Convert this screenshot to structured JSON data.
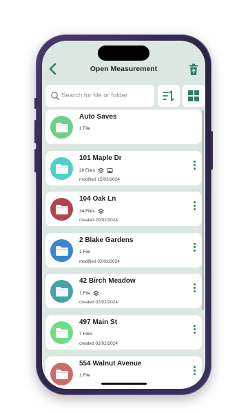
{
  "header": {
    "title": "Open Measurement",
    "back_icon": "chevron-left-icon",
    "delete_icon": "trash-icon"
  },
  "search": {
    "placeholder": "Search for file or folder",
    "sort_icon": "sort-icon",
    "view_icon": "grid-view-icon"
  },
  "colors": {
    "accent": "#2e7d63",
    "background": "#dce7e1"
  },
  "folders": [
    {
      "name": "Auto Saves",
      "files": "1 File",
      "date": "",
      "color": "#6fcf8a",
      "icons": []
    },
    {
      "name": "101 Maple Dr",
      "files": "20 Files",
      "date": "modified 15/03/2024",
      "color": "#4fd1c5",
      "icons": [
        "layers-icon",
        "image-icon"
      ]
    },
    {
      "name": "104 Oak Ln",
      "files": "34 Files",
      "date": "created 20/02/2024",
      "color": "#b0454e",
      "icons": [
        "layers-icon"
      ]
    },
    {
      "name": "2 Blake Gardens",
      "files": "1 File",
      "date": "modified 02/02/2024",
      "color": "#3a86c8",
      "icons": []
    },
    {
      "name": "42 Birch Meadow",
      "files": "1 File",
      "date": "created 02/02/2024",
      "color": "#4aa0a8",
      "icons": [
        "layers-icon"
      ]
    },
    {
      "name": "497 Main St",
      "files": "7 Files",
      "date": "created 02/02/2024",
      "color": "#6fdd85",
      "icons": []
    },
    {
      "name": "554 Walnut Avenue",
      "files": "1 File",
      "date": "",
      "color": "#c96a6c",
      "icons": []
    }
  ]
}
